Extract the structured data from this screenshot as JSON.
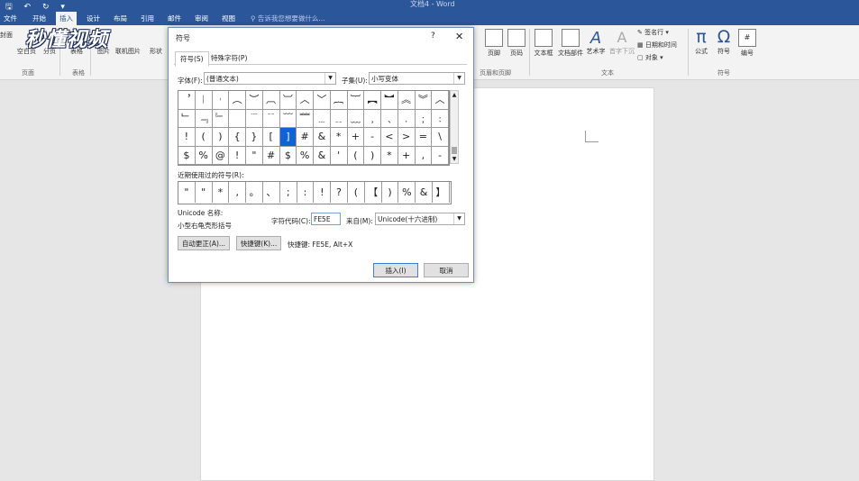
{
  "window": {
    "title": "文档4 - Word"
  },
  "qat": {
    "save": "🖫",
    "undo": "↶",
    "redo": "↻",
    "more": "▾"
  },
  "menu": {
    "tabs": [
      "文件",
      "开始",
      "插入",
      "设计",
      "布局",
      "引用",
      "邮件",
      "审阅",
      "视图"
    ],
    "active": "插入",
    "tell_me": "告诉我您想要做什么..."
  },
  "logo_text": "秒懂视频",
  "ribbon": {
    "left_items": [
      "封面",
      "空白页",
      "分页",
      "表格",
      "图片",
      "联机图片",
      "形状"
    ],
    "groups": {
      "pages": "页面",
      "tables": "表格",
      "header_footer": "页眉和页脚",
      "text": "文本",
      "symbols": "符号"
    },
    "header_footer_items": [
      "页脚",
      "页码"
    ],
    "text_items": [
      "文本框",
      "文档部件",
      "艺术字",
      "首字下沉"
    ],
    "text_side": [
      "签名行",
      "日期和时间",
      "对象"
    ],
    "symbol_items": [
      "公式",
      "符号",
      "编号"
    ],
    "symbol_icons": [
      "π",
      "Ω",
      "#"
    ]
  },
  "dialog": {
    "title": "符号",
    "help": "?",
    "close": "✕",
    "tabs": [
      "符号(S)",
      "特殊字符(P)"
    ],
    "font_label": "字体(F):",
    "font_value": "(普通文本)",
    "subset_label": "子集(U):",
    "subset_value": "小写变体",
    "grid_rows": [
      [
        "︐",
        "︱",
        "︲",
        "︵",
        "︶",
        "︹",
        "︺",
        "︿",
        "﹀",
        "︷",
        "︸",
        "︻",
        "︼",
        "︽",
        "︾",
        "︿",
        "﹀"
      ],
      [
        "﹂",
        "﹃",
        "﹄",
        "",
        "﹉",
        "﹊",
        "﹋",
        "﹌",
        "﹍",
        "﹎",
        "﹏",
        "﹐",
        "﹑",
        "﹒",
        "﹔",
        "﹕",
        "?"
      ],
      [
        "!",
        "(",
        ")",
        "{",
        "}",
        "[",
        "]",
        "#",
        "&",
        "*",
        "+",
        "-",
        "<",
        ">",
        "=",
        "\\"
      ],
      [
        "$",
        "%",
        "@",
        "!",
        "\"",
        "#",
        "$",
        "%",
        "&",
        "'",
        "(",
        ")",
        "*",
        "+",
        ",",
        "-"
      ]
    ],
    "selected": {
      "row": 2,
      "col": 6
    },
    "recent_label": "近期使用过的符号(R):",
    "recent": [
      "\"",
      "\"",
      "*",
      ",",
      "。",
      "、",
      ";",
      ":",
      "!",
      "?",
      "(",
      "【",
      ")",
      "%",
      "&",
      "】"
    ],
    "unicode_name_label": "Unicode 名称:",
    "unicode_name_value": "小型右龟壳形括号",
    "charcode_label": "字符代码(C):",
    "charcode_value": "FE5E",
    "from_label": "来自(M):",
    "from_value": "Unicode(十六进制)",
    "autocorrect_button": "自动更正(A)...",
    "shortcut_button": "快捷键(K)...",
    "shortcut_text": "快捷键: FE5E, Alt+X",
    "insert_button": "插入(I)",
    "cancel_button": "取消"
  }
}
